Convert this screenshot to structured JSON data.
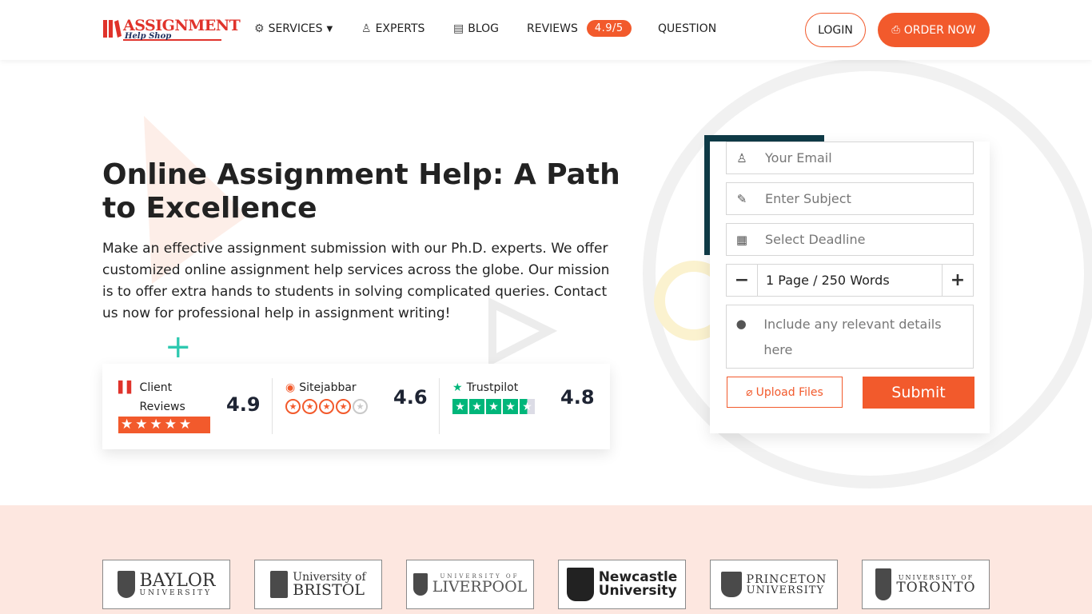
{
  "header": {
    "logo_word": "ASSIGNMENT",
    "logo_sub": "Help Shop",
    "nav": [
      {
        "label": "SERVICES",
        "icon": "gear-icon"
      },
      {
        "label": "EXPERTS",
        "icon": "user-icon"
      },
      {
        "label": "BLOG",
        "icon": "document-icon"
      },
      {
        "label": "REVIEWS",
        "badge": "4.9/5"
      },
      {
        "label": "QUESTION"
      }
    ],
    "login_label": "LOGIN",
    "order_label": "ORDER NOW"
  },
  "hero": {
    "title": "Online Assignment Help: A Path to Excellence",
    "description": "Make an effective assignment submission with our Ph.D. experts. We offer customized online assignment help services across the globe. Our mission is to offer extra hands to students in solving complicated queries. Contact us now for professional help in assignment writing!"
  },
  "ratings": [
    {
      "label": "Client Reviews",
      "score": "4.9",
      "stars": 5
    },
    {
      "label": "Sitejabbar",
      "score": "4.6",
      "stars": 4
    },
    {
      "label": "Trustpilot",
      "score": "4.8",
      "stars": 4.5
    }
  ],
  "form": {
    "email_placeholder": "Your Email",
    "subject_placeholder": "Enter Subject",
    "deadline_placeholder": "Select Deadline",
    "pages_value": "1 Page / 250 Words",
    "details_placeholder": "Include any relevant details here",
    "upload_label": "Upload Files",
    "submit_label": "Submit"
  },
  "universities": [
    {
      "line1": "BAYLOR",
      "line2": "UNIVERSITY"
    },
    {
      "line1": "University of",
      "line2": "BRISTOL"
    },
    {
      "line1": "UNIVERSITY OF",
      "line2": "LIVERPOOL"
    },
    {
      "line1": "Newcastle",
      "line2": "University"
    },
    {
      "line1": "PRINCETON",
      "line2": "UNIVERSITY"
    },
    {
      "line1": "UNIVERSITY OF",
      "line2": "TORONTO"
    }
  ],
  "colors": {
    "accent": "#f25a2c",
    "dark": "#0f3b47",
    "band": "#fde7e0"
  }
}
